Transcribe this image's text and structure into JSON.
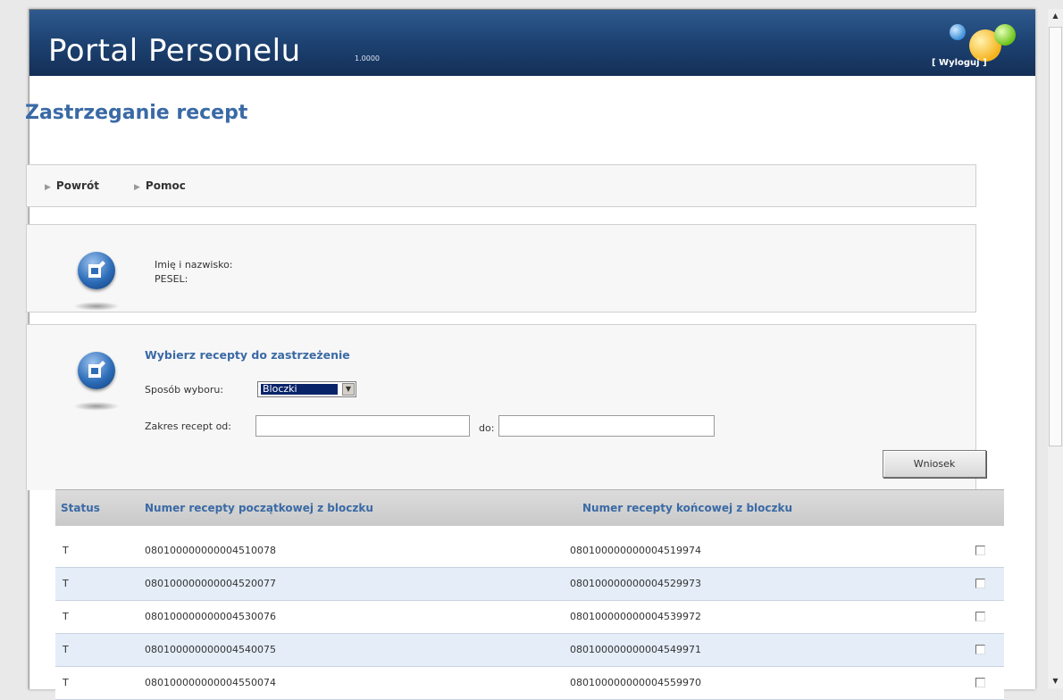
{
  "header": {
    "title": "Portal Personelu",
    "version": "1.0000",
    "logout_label": "[ Wyloguj ]"
  },
  "page": {
    "title": "Zastrzeganie recept"
  },
  "nav": {
    "items": [
      {
        "label": "Powrót"
      },
      {
        "label": "Pomoc"
      }
    ]
  },
  "info": {
    "name_label": "Imię i nazwisko:",
    "pesel_label": "PESEL:"
  },
  "selection": {
    "title": "Wybierz recepty do zastrzeżenie",
    "mode_label": "Sposób wyboru:",
    "mode_value": "Bloczki",
    "range_from_label": "Zakres recept od:",
    "range_from_value": "",
    "range_to_label": "do:",
    "range_to_value": "",
    "submit_label": "Wniosek"
  },
  "table": {
    "headers": [
      "Status",
      "Numer recepty początkowej z bloczku",
      "Numer recepty końcowej z bloczku"
    ],
    "rows": [
      {
        "status": "T",
        "start": "080100000000004510078",
        "end": "080100000000004519974",
        "checked": false
      },
      {
        "status": "T",
        "start": "080100000000004520077",
        "end": "080100000000004529973",
        "checked": false
      },
      {
        "status": "T",
        "start": "080100000000004530076",
        "end": "080100000000004539972",
        "checked": false
      },
      {
        "status": "T",
        "start": "080100000000004540075",
        "end": "080100000000004549971",
        "checked": false
      },
      {
        "status": "T",
        "start": "080100000000004550074",
        "end": "080100000000004559970",
        "checked": false
      }
    ]
  },
  "colors": {
    "header_bg": "#1e4474",
    "accent": "#3a6aa5",
    "row_alt": "#e4edf8"
  },
  "icons": {
    "edit_icon": "edit-document-icon",
    "nav_arrow": "triangle-right-icon"
  }
}
